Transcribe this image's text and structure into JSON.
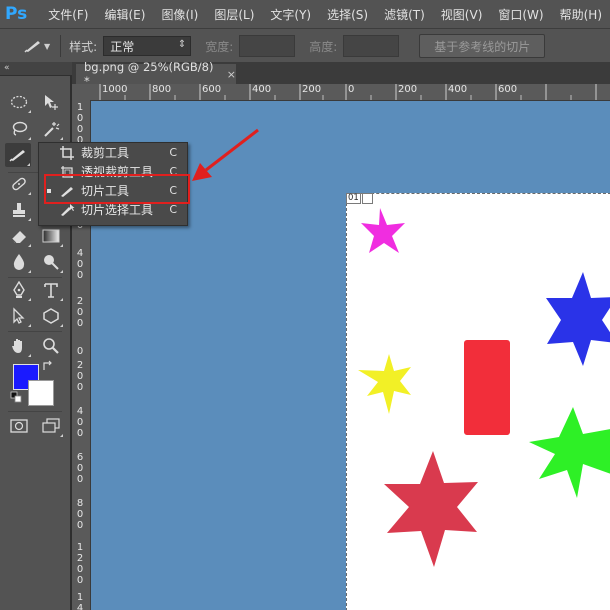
{
  "app": {
    "logo": "Ps"
  },
  "menu": [
    "文件(F)",
    "编辑(E)",
    "图像(I)",
    "图层(L)",
    "文字(Y)",
    "选择(S)",
    "滤镜(T)",
    "视图(V)",
    "窗口(W)",
    "帮助(H)"
  ],
  "options": {
    "style_label": "样式:",
    "style_value": "正常",
    "width_label": "宽度:",
    "height_label": "高度:",
    "guides_button": "基于参考线的切片"
  },
  "document": {
    "tab_title": "bg.png @ 25%(RGB/8) *",
    "close": "×",
    "slice_number": "01"
  },
  "ruler": {
    "top": [
      "1000",
      "800",
      "600",
      "400",
      "200",
      "0",
      "200",
      "400",
      "600"
    ],
    "left": [
      [
        "1",
        "0",
        "0",
        "0"
      ],
      [
        "8",
        "0",
        "0"
      ],
      [
        "6",
        "0",
        "0"
      ],
      [
        "4",
        "0",
        "0"
      ],
      [
        "2",
        "0",
        "0"
      ],
      [
        "0"
      ],
      [
        "2",
        "0",
        "0"
      ],
      [
        "4",
        "0",
        "0"
      ],
      [
        "6",
        "0",
        "0"
      ],
      [
        "8",
        "0",
        "0"
      ],
      [
        "1",
        "0",
        "0",
        "0"
      ],
      [
        "1",
        "2",
        "0",
        "0"
      ],
      [
        "1",
        "4",
        "0",
        "0"
      ]
    ]
  },
  "flyout": {
    "items": [
      {
        "label": "裁剪工具",
        "key": "C",
        "icon": "crop-icon"
      },
      {
        "label": "透视裁剪工具",
        "key": "C",
        "icon": "perspective-crop-icon"
      },
      {
        "label": "切片工具",
        "key": "C",
        "icon": "slice-icon",
        "selected": true
      },
      {
        "label": "切片选择工具",
        "key": "C",
        "icon": "slice-select-icon"
      }
    ]
  },
  "colors": {
    "foreground": "#1a1aff",
    "background": "#ffffff",
    "canvas_bg": "#5b8dbb",
    "highlight": "#e0201e"
  },
  "shapes": [
    "magenta-star",
    "blue-star",
    "yellow-star",
    "red-rectangle",
    "green-star",
    "crimson-star"
  ]
}
